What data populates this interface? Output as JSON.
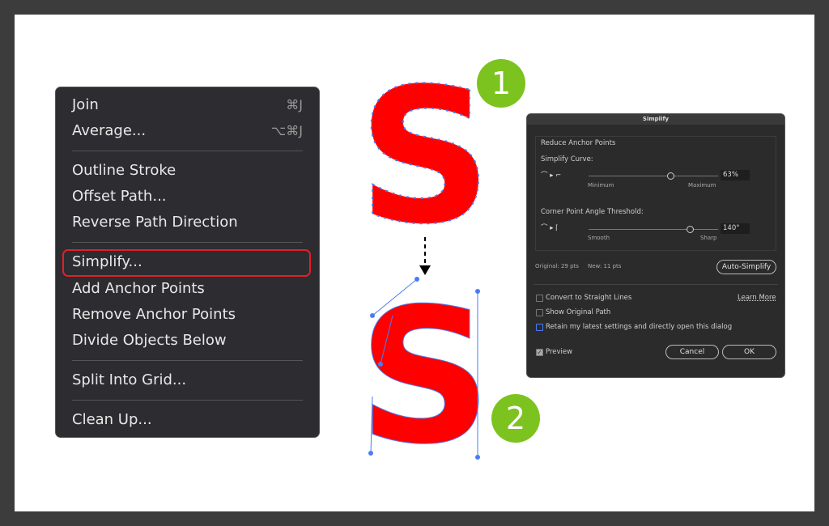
{
  "menu": {
    "items": [
      {
        "label": "Join",
        "shortcut": "⌘J"
      },
      {
        "label": "Average...",
        "shortcut": "⌥⌘J"
      },
      {
        "label": "Outline Stroke"
      },
      {
        "label": "Offset Path..."
      },
      {
        "label": "Reverse Path Direction"
      },
      {
        "label": "Simplify...",
        "highlighted": true
      },
      {
        "label": "Add Anchor Points"
      },
      {
        "label": "Remove Anchor Points"
      },
      {
        "label": "Divide Objects Below"
      },
      {
        "label": "Split Into Grid..."
      },
      {
        "label": "Clean Up..."
      }
    ],
    "highlight_color": "#e0202a"
  },
  "artwork": {
    "letter": "S",
    "fill": "#ff0000",
    "path_color": "#4a7cf5",
    "badges": [
      "1",
      "2"
    ],
    "badge_color": "#7cc31f"
  },
  "dialog": {
    "title": "Simplify",
    "group_label": "Reduce Anchor Points",
    "simplify_curve": {
      "label": "Simplify Curve:",
      "min": "Minimum",
      "max": "Maximum",
      "value": "63%",
      "level": 63
    },
    "corner": {
      "label": "Corner Point Angle Threshold:",
      "min": "Smooth",
      "max": "Sharp",
      "value": "140°",
      "level": 78
    },
    "stats": {
      "original": "Original: 29 pts",
      "new": "New: 11 pts"
    },
    "auto_simplify": "Auto-Simplify",
    "convert_straight": {
      "label": "Convert to Straight Lines",
      "checked": false
    },
    "learn_more": "Learn More",
    "show_original": {
      "label": "Show Original Path",
      "checked": false
    },
    "retain": {
      "label": "Retain my latest settings and directly open this dialog",
      "checked": false
    },
    "preview": {
      "label": "Preview",
      "checked": true
    },
    "cancel": "Cancel",
    "ok": "OK"
  }
}
